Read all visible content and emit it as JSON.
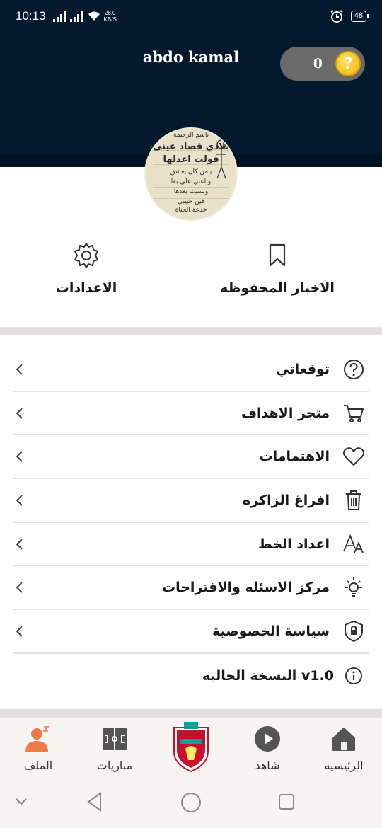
{
  "status_bar": {
    "time": "10:13",
    "net_speed": "28.0",
    "net_unit": "KB/S",
    "battery": "48"
  },
  "header": {
    "username": "abdo kamal",
    "coins": "0",
    "coin_symbol": "?"
  },
  "avatar": {
    "lines": [
      "باسم الرحيمة",
      "بلادي قصاد عيني",
      "فولت اعدلها",
      "يامن كان يعشق",
      "وباعني علي بقا",
      "ونسيت بعدها",
      "فين حبيبي",
      "خدعة الحياة"
    ]
  },
  "quick_actions": {
    "saved_news": "الاخبار المحفوظه",
    "settings": "الاعدادات"
  },
  "menu": [
    {
      "label": "توقعاتي",
      "icon": "question-circle-icon"
    },
    {
      "label": "متجر الاهداف",
      "icon": "cart-icon"
    },
    {
      "label": "الاهتمامات",
      "icon": "heart-icon"
    },
    {
      "label": "افراغ الزاكره",
      "icon": "trash-icon"
    },
    {
      "label": "اعداد الخط",
      "icon": "font-size-icon"
    },
    {
      "label": "مركز الاسئله والاقتراحات",
      "icon": "lightbulb-icon"
    },
    {
      "label": "سياسة الخصوصية",
      "icon": "shield-lock-icon"
    },
    {
      "label": "النسخة الحاليه v1.0",
      "icon": "info-icon"
    }
  ],
  "bottom_nav": {
    "home": "الرئيسيه",
    "watch": "شاهد",
    "matches": "مباريات",
    "profile": "الملف"
  },
  "colors": {
    "header_bg": "#03192e",
    "accent": "#f07a4a",
    "nav_gray": "#555555"
  }
}
